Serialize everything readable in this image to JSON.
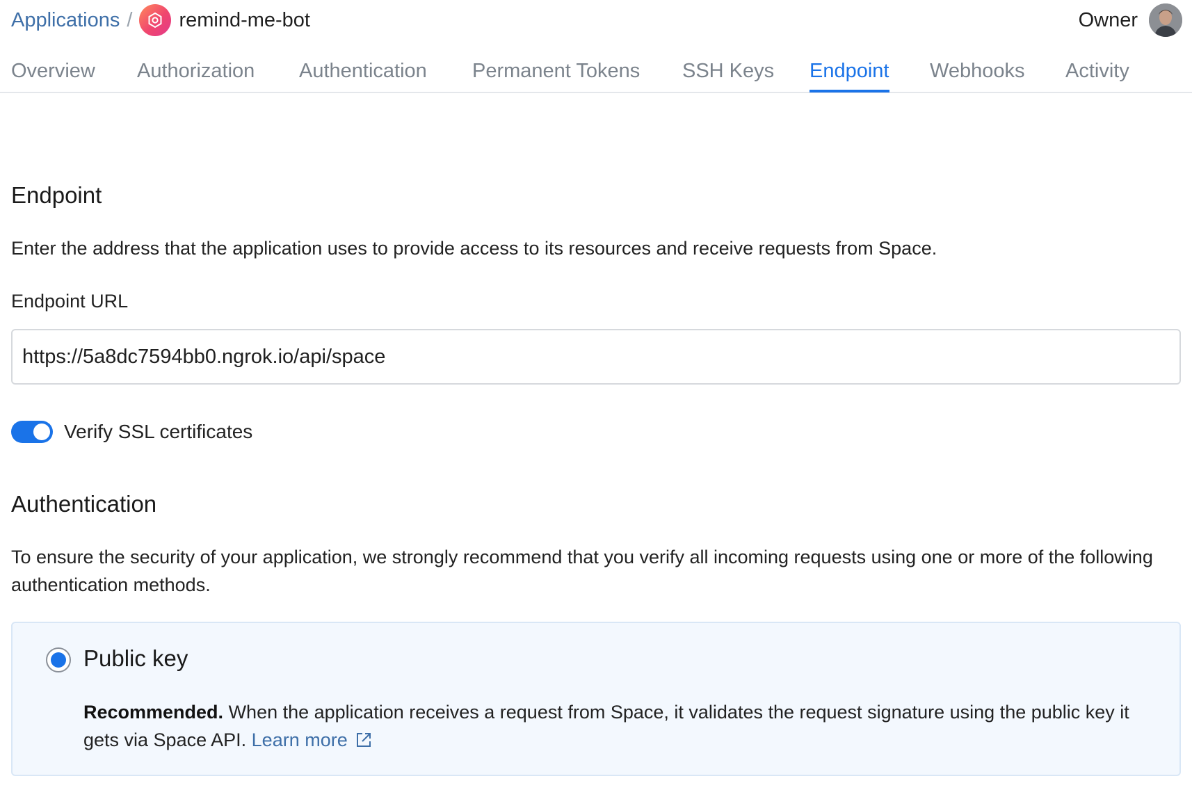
{
  "breadcrumb": {
    "parent": "Applications",
    "separator": "/",
    "app_name": "remind-me-bot",
    "app_icon": "app-logo-icon"
  },
  "header": {
    "role": "Owner",
    "avatar": "user-avatar"
  },
  "tabs": [
    {
      "label": "Overview",
      "active": false
    },
    {
      "label": "Authorization",
      "active": false
    },
    {
      "label": "Authentication",
      "active": false
    },
    {
      "label": "Permanent Tokens",
      "active": false
    },
    {
      "label": "SSH Keys",
      "active": false
    },
    {
      "label": "Endpoint",
      "active": true
    },
    {
      "label": "Webhooks",
      "active": false
    },
    {
      "label": "Activity",
      "active": false
    }
  ],
  "endpoint": {
    "title": "Endpoint",
    "description": "Enter the address that the application uses to provide access to its resources and receive requests from Space.",
    "url_label": "Endpoint URL",
    "url_value": "https://5a8dc7594bb0.ngrok.io/api/space",
    "ssl_toggle_label": "Verify SSL certificates",
    "ssl_toggle_on": true
  },
  "authentication": {
    "title": "Authentication",
    "description": "To ensure the security of your application, we strongly recommend that you verify all incoming requests using one or more of the following authentication methods.",
    "methods": [
      {
        "label": "Public key",
        "selected": true,
        "emphasis": "Recommended.",
        "text": " When the application receives a request from Space, it validates the request signature using the public key it gets via Space API. ",
        "link_label": "Learn more",
        "link_icon": "external-link-icon"
      }
    ]
  },
  "colors": {
    "accent": "#1a73e8",
    "link": "#3e6fa8",
    "card_bg": "#f3f8fe"
  }
}
